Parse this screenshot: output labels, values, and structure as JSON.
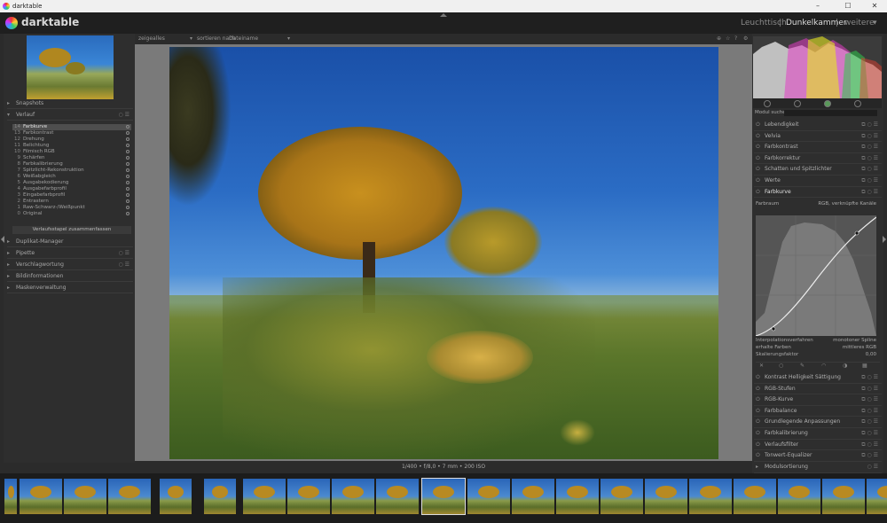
{
  "window": {
    "title": "darktable",
    "min": "–",
    "max": "☐",
    "close": "✕"
  },
  "app": {
    "logo_text": "darktable"
  },
  "views": [
    {
      "label": "Leuchttisch",
      "active": false
    },
    {
      "label": "Dunkelkammer",
      "active": true
    },
    {
      "label": "weitere",
      "active": false
    }
  ],
  "view_sep": "|",
  "more_arrow": "▾",
  "toolbar": {
    "show_label": "zeige",
    "show_value": "alles",
    "sort_label": "sortieren nach",
    "sort_value": "Dateiname"
  },
  "left": {
    "snapshots": "Snapshots",
    "history_title": "Verlauf",
    "history": [
      {
        "n": "14",
        "label": "Farbkurve"
      },
      {
        "n": "13",
        "label": "Farbkontrast"
      },
      {
        "n": "12",
        "label": "Drehung"
      },
      {
        "n": "11",
        "label": "Belichtung"
      },
      {
        "n": "10",
        "label": "Filmisch RGB"
      },
      {
        "n": "9",
        "label": "Schärfen"
      },
      {
        "n": "8",
        "label": "Farbkalibrierung"
      },
      {
        "n": "7",
        "label": "Spitzlicht-Rekonstruktion"
      },
      {
        "n": "6",
        "label": "Weißabgleich"
      },
      {
        "n": "5",
        "label": "Ausgabekodierung"
      },
      {
        "n": "4",
        "label": "Ausgabefarbprofil"
      },
      {
        "n": "3",
        "label": "Eingabefarbprofil"
      },
      {
        "n": "2",
        "label": "Entrastern"
      },
      {
        "n": "1",
        "label": "Raw-Schwarz-/Weißpunkt"
      },
      {
        "n": "0",
        "label": "Original"
      }
    ],
    "compress_label": "Verlaufsstapel zusammenfassen",
    "sections": [
      "Duplikat-Manager",
      "Pipette",
      "Verschlagwortung",
      "Bildinformationen",
      "Maskenverwaltung"
    ]
  },
  "info_bar": "1/400 • f/8,0 • 7 mm • 200 ISO",
  "right": {
    "search_label": "Modul suchen",
    "modules_top": [
      "Lebendigkeit",
      "Velvia",
      "Farbkontrast",
      "Farbkorrektur",
      "Schatten und Spitzlichter",
      "Werte",
      "Farbkurve"
    ],
    "curve_params": {
      "farbraum_label": "Farbraum",
      "farbraum_value": "RGB, verknüpfte Kanäle",
      "interp_label": "Interpolationsverfahren",
      "interp_value": "monotoner Spline",
      "preserve_label": "erhalte Farben",
      "preserve_value": "mittleres RGB",
      "scale_label": "Skalierungsfaktor",
      "scale_value": "0,00"
    },
    "modules_bottom": [
      "Kontrast Helligkeit Sättigung",
      "RGB-Stufen",
      "RGB-Kurve",
      "Farbbalance",
      "Grundlegende Anpassungen",
      "Farbkalibrierung",
      "Verlaufsfilter",
      "Tonwert-Equalizer"
    ],
    "module_order": "Modulsortierung"
  },
  "colors": {
    "accent": "#d8d8d8",
    "panel": "#2e2e2e",
    "background": "#7a7a7a"
  }
}
